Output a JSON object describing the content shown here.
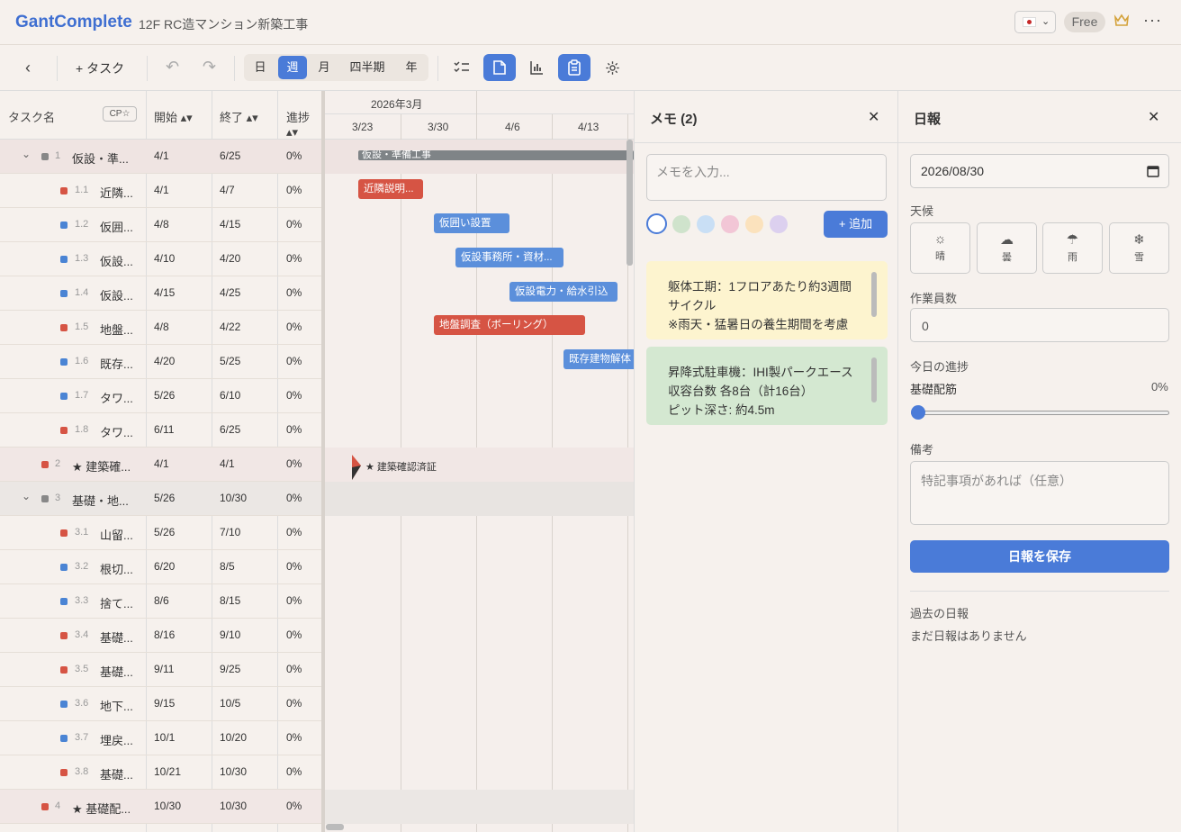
{
  "app": {
    "logo": "GantComplete",
    "project": "12F RC造マンション新築工事",
    "free_badge": "Free",
    "more": "···"
  },
  "toolbar": {
    "back": "‹",
    "add_task": "+ タスク",
    "undo": "↶",
    "redo": "↷",
    "views": [
      "日",
      "週",
      "月",
      "四半期",
      "年"
    ],
    "active_view": "週"
  },
  "grid": {
    "col_task": "タスク名",
    "cp_btn": "CP☆",
    "col_start": "開始 ▴▾",
    "col_end": "終了 ▴▾",
    "col_progress": "進捗 ▴▾"
  },
  "tasks": [
    {
      "num": "1",
      "name": "仮設・準...",
      "start": "4/1",
      "end": "6/25",
      "progress": "0%",
      "color": "#888888"
    },
    {
      "num": "1.1",
      "name": "近隣...",
      "start": "4/1",
      "end": "4/7",
      "progress": "0%",
      "color": "#d65444"
    },
    {
      "num": "1.2",
      "name": "仮囲...",
      "start": "4/8",
      "end": "4/15",
      "progress": "0%",
      "color": "#4a84d4"
    },
    {
      "num": "1.3",
      "name": "仮設...",
      "start": "4/10",
      "end": "4/20",
      "progress": "0%",
      "color": "#4a84d4"
    },
    {
      "num": "1.4",
      "name": "仮設...",
      "start": "4/15",
      "end": "4/25",
      "progress": "0%",
      "color": "#4a84d4"
    },
    {
      "num": "1.5",
      "name": "地盤...",
      "start": "4/8",
      "end": "4/22",
      "progress": "0%",
      "color": "#d65444"
    },
    {
      "num": "1.6",
      "name": "既存...",
      "start": "4/20",
      "end": "5/25",
      "progress": "0%",
      "color": "#4a84d4"
    },
    {
      "num": "1.7",
      "name": "タワ...",
      "start": "5/26",
      "end": "6/10",
      "progress": "0%",
      "color": "#4a84d4"
    },
    {
      "num": "1.8",
      "name": "タワ...",
      "start": "6/11",
      "end": "6/25",
      "progress": "0%",
      "color": "#d65444"
    },
    {
      "num": "2",
      "name": "★ 建築確...",
      "start": "4/1",
      "end": "4/1",
      "progress": "0%",
      "color": "#d65444"
    },
    {
      "num": "3",
      "name": "基礎・地...",
      "start": "5/26",
      "end": "10/30",
      "progress": "0%",
      "color": "#888888"
    },
    {
      "num": "3.1",
      "name": "山留...",
      "start": "5/26",
      "end": "7/10",
      "progress": "0%",
      "color": "#d65444"
    },
    {
      "num": "3.2",
      "name": "根切...",
      "start": "6/20",
      "end": "8/5",
      "progress": "0%",
      "color": "#4a84d4"
    },
    {
      "num": "3.3",
      "name": "捨て...",
      "start": "8/6",
      "end": "8/15",
      "progress": "0%",
      "color": "#4a84d4"
    },
    {
      "num": "3.4",
      "name": "基礎...",
      "start": "8/16",
      "end": "9/10",
      "progress": "0%",
      "color": "#d65444"
    },
    {
      "num": "3.5",
      "name": "基礎...",
      "start": "9/11",
      "end": "9/25",
      "progress": "0%",
      "color": "#d65444"
    },
    {
      "num": "3.6",
      "name": "地下...",
      "start": "9/15",
      "end": "10/5",
      "progress": "0%",
      "color": "#4a84d4"
    },
    {
      "num": "3.7",
      "name": "埋戻...",
      "start": "10/1",
      "end": "10/20",
      "progress": "0%",
      "color": "#4a84d4"
    },
    {
      "num": "3.8",
      "name": "基礎...",
      "start": "10/21",
      "end": "10/30",
      "progress": "0%",
      "color": "#d65444"
    },
    {
      "num": "4",
      "name": "★ 基礎配...",
      "start": "10/30",
      "end": "10/30",
      "progress": "0%",
      "color": "#d65444"
    }
  ],
  "gantt": {
    "month": "2026年3月",
    "weeks": [
      "3/23",
      "3/30",
      "4/6",
      "4/13"
    ],
    "bars": [
      {
        "label": "仮設・準備工事",
        "color": "#7f8487"
      },
      {
        "label": "近隣説明...",
        "color": "#d65444"
      },
      {
        "label": "仮囲い設置",
        "color": "#5b8fdb"
      },
      {
        "label": "仮設事務所・資材...",
        "color": "#5b8fdb"
      },
      {
        "label": "仮設電力・給水引込",
        "color": "#5b8fdb"
      },
      {
        "label": "地盤調査（ボーリング）",
        "color": "#d65444"
      },
      {
        "label": "既存建物解体",
        "color": "#5b8fdb"
      }
    ],
    "milestone": "★ 建築確認済証"
  },
  "memo": {
    "title": "メモ (2)",
    "close": "✕",
    "placeholder": "メモを入力...",
    "add": "+ 追加",
    "colors": [
      "#ffffff",
      "#cfe3cc",
      "#c9dff5",
      "#f2c6d6",
      "#fbe2bd",
      "#dcd0ef"
    ],
    "cards": [
      {
        "text": "躯体工期：1フロアあたり約3週間サイクル\n※雨天・猛暑日の養生期間を考慮",
        "bg": "#fdf4cf"
      },
      {
        "text": "昇降式駐車機：IHI製パークエース\n収容台数 各8台（計16台）\nピット深さ: 約4.5m",
        "bg": "#d4e8d1"
      }
    ]
  },
  "report": {
    "title": "日報",
    "close": "✕",
    "date": "2026/08/30",
    "weather_label": "天候",
    "weather": [
      {
        "icon": "☼",
        "label": "晴"
      },
      {
        "icon": "☁",
        "label": "曇"
      },
      {
        "icon": "☂",
        "label": "雨"
      },
      {
        "icon": "❄",
        "label": "雪"
      }
    ],
    "workers_label": "作業員数",
    "workers": "0",
    "progress_label": "今日の進捗",
    "progress_task": "基礎配筋",
    "progress_value": "0%",
    "progress_fraction": 0,
    "notes_label": "備考",
    "notes_placeholder": "特記事項があれば（任意）",
    "save": "日報を保存",
    "past_label": "過去の日報",
    "past_empty": "まだ日報はありません"
  }
}
